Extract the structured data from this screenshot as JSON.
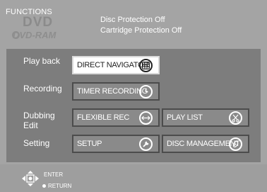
{
  "header": {
    "functions": "FUNCTIONS",
    "logo_dvd": "DVD",
    "logo_ram": "DVD-RAM",
    "disc_protection": "Disc Protection   Off",
    "cartridge_protection": "Cartridge Protection   Off"
  },
  "rows": {
    "playback": "Play back",
    "recording": "Recording",
    "dubbing": "Dubbing",
    "edit": "Edit",
    "setting": "Setting"
  },
  "buttons": {
    "direct_navigator": "DIRECT NAVIGATOR",
    "timer_recording": "TIMER RECORDING",
    "flexible_rec": "FLEXIBLE REC",
    "play_list": "PLAY LIST",
    "setup": "SETUP",
    "disc_management": "DISC MANAGEMENT"
  },
  "icons": {
    "direct_navigator": "grid-icon",
    "timer_recording": "clock-icon",
    "flexible_rec": "arrows-icon",
    "play_list": "scissors-icon",
    "setup": "wrench-icon",
    "disc_management": "disc-icon"
  },
  "footer": {
    "enter": "ENTER",
    "return": "RETURN"
  }
}
